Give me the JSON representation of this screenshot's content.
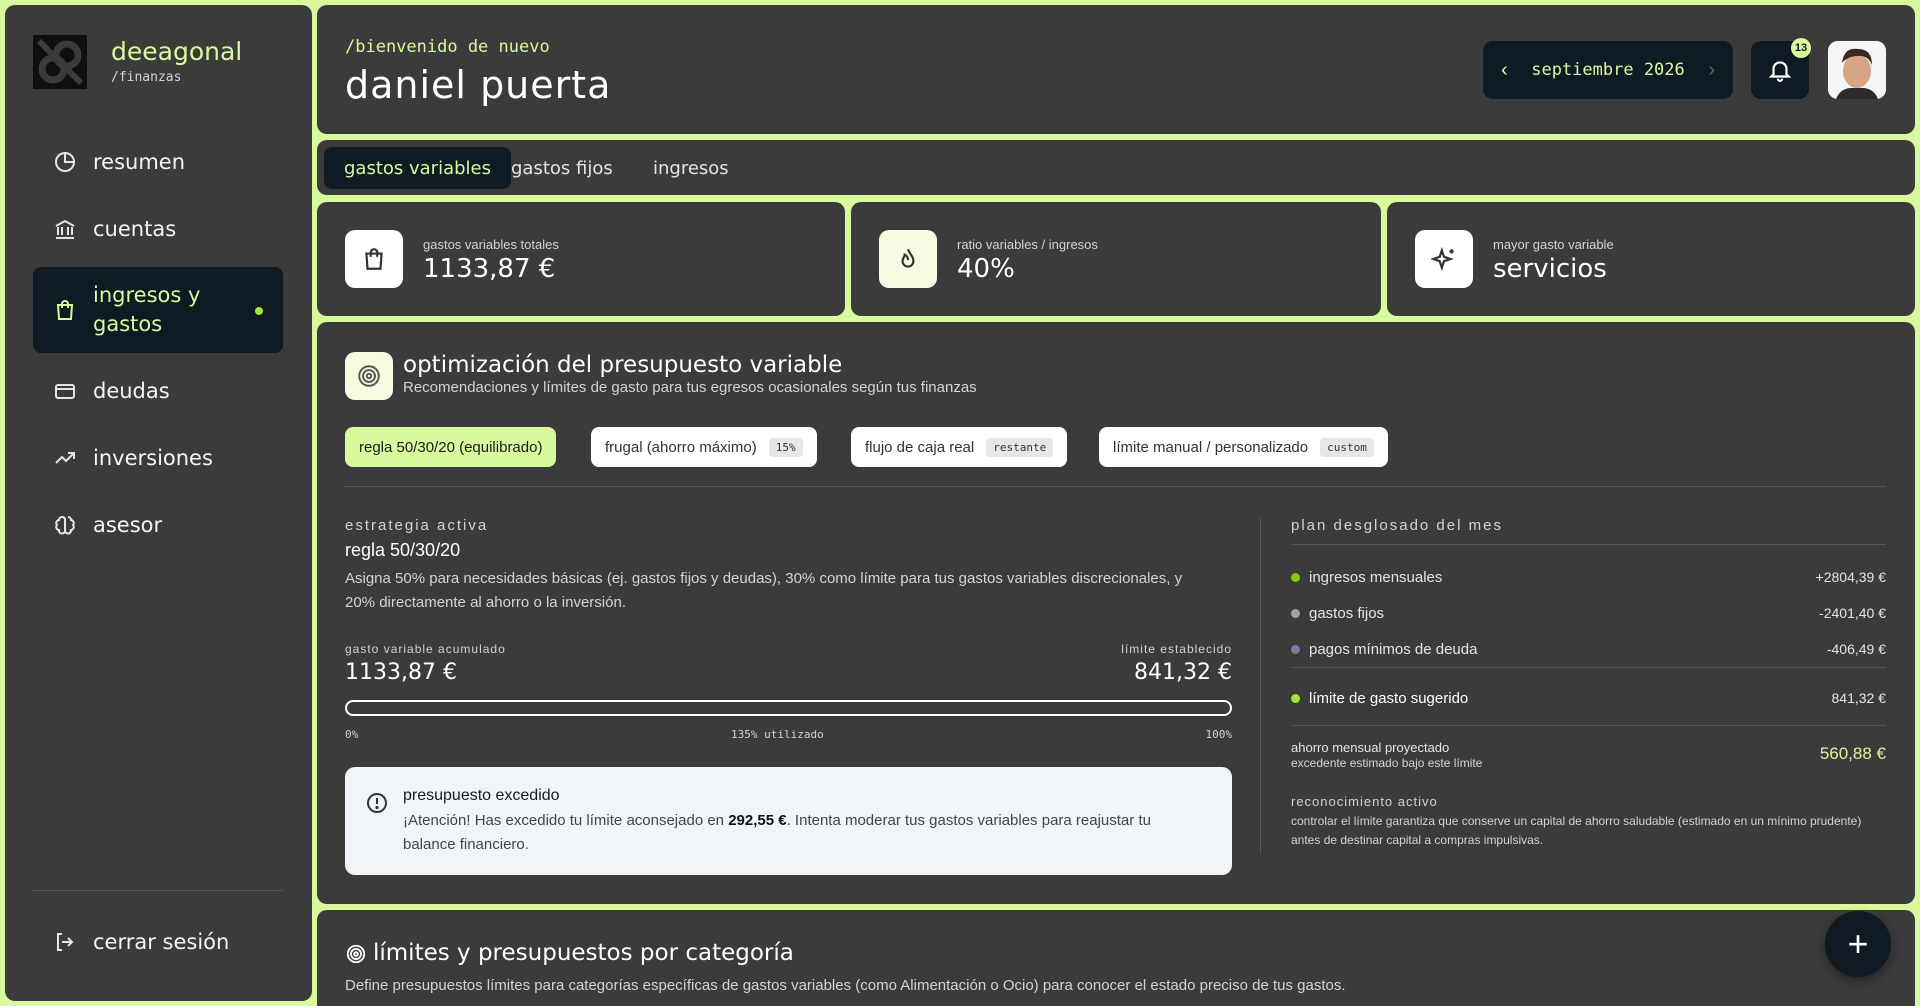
{
  "brand": {
    "name": "deeagonal",
    "sub": "/finanzas"
  },
  "sidebar": {
    "items": [
      {
        "label": "resumen",
        "icon": "pie-chart-icon"
      },
      {
        "label": "cuentas",
        "icon": "bank-icon"
      },
      {
        "label": "ingresos y gastos",
        "icon": "shopping-bag-icon",
        "active": true
      },
      {
        "label": "deudas",
        "icon": "credit-card-icon"
      },
      {
        "label": "inversiones",
        "icon": "trending-up-icon"
      },
      {
        "label": "asesor",
        "icon": "brain-icon"
      }
    ],
    "logout": "cerrar sesión"
  },
  "header": {
    "welcome": "/bienvenido de nuevo",
    "user": "daniel puerta",
    "month": "septiembre 2026",
    "notifications": "13"
  },
  "tabs": [
    "gastos variables",
    "gastos fijos",
    "ingresos"
  ],
  "stats": [
    {
      "label": "gastos variables totales",
      "value": "1133,87 €",
      "icon": "shopping-bag-icon"
    },
    {
      "label": "ratio variables / ingresos",
      "value": "40%",
      "icon": "flame-icon"
    },
    {
      "label": "mayor gasto variable",
      "value": "servicios",
      "icon": "sparkles-icon"
    }
  ],
  "optimization": {
    "title": "optimización del presupuesto variable",
    "subtitle": "Recomendaciones y límites de gasto para tus egresos ocasionales según tus finanzas",
    "chips": [
      {
        "label": "regla 50/30/20 (equilibrado)",
        "tag": "",
        "active": true
      },
      {
        "label": "frugal (ahorro máximo)",
        "tag": "15%"
      },
      {
        "label": "flujo de caja real",
        "tag": "restante"
      },
      {
        "label": "límite manual / personalizado",
        "tag": "custom"
      }
    ],
    "strategy_label": "estrategia activa",
    "strategy_name": "regla 50/30/20",
    "strategy_desc": "Asigna 50% para necesidades básicas (ej. gastos fijos y deudas), 30% como límite para tus gastos variables discrecionales, y 20% directamente al ahorro o la inversión.",
    "accum_label": "gasto variable acumulado",
    "accum_value": "1133,87 €",
    "limit_label": "límite establecido",
    "limit_value": "841,32 €",
    "progress_percent": 135,
    "prog_min": "0%",
    "prog_mid": "135% utilizado",
    "prog_max": "100%",
    "alert": {
      "title": "presupuesto excedido",
      "pre": "¡Atención! Has excedido tu límite aconsejado en ",
      "amount": "292,55 €",
      "post": ". Intenta moderar tus gastos variables para reajustar tu balance financiero."
    },
    "plan": {
      "label": "plan desglosado del mes",
      "rows": [
        {
          "label": "ingresos mensuales",
          "amount": "+2804,39 €",
          "color": "#84cc16"
        },
        {
          "label": "gastos fijos",
          "amount": "-2401,40 €",
          "color": "#a3a3a3"
        },
        {
          "label": "pagos mínimos de deuda",
          "amount": "-406,49 €",
          "color": "#71809a"
        },
        {
          "label": "límite de gasto sugerido",
          "amount": "841,32 €",
          "color": "#a3e635"
        }
      ],
      "proj_title": "ahorro mensual proyectado",
      "proj_sub": "excedente estimado bajo este límite",
      "proj_amount": "560,88 €",
      "recog_title": "reconocimiento activo",
      "recog_body": "controlar el límite garantiza que conserve un capital de ahorro saludable (estimado en un mínimo prudente) antes de destinar capital a compras impulsivas."
    }
  },
  "limits": {
    "title": "límites y presupuestos por categoría",
    "subtitle": "Define presupuestos límites para categorías específicas de gastos variables (como Alimentación o Ocio) para conocer el estado preciso de tus gastos."
  },
  "fab": "+"
}
